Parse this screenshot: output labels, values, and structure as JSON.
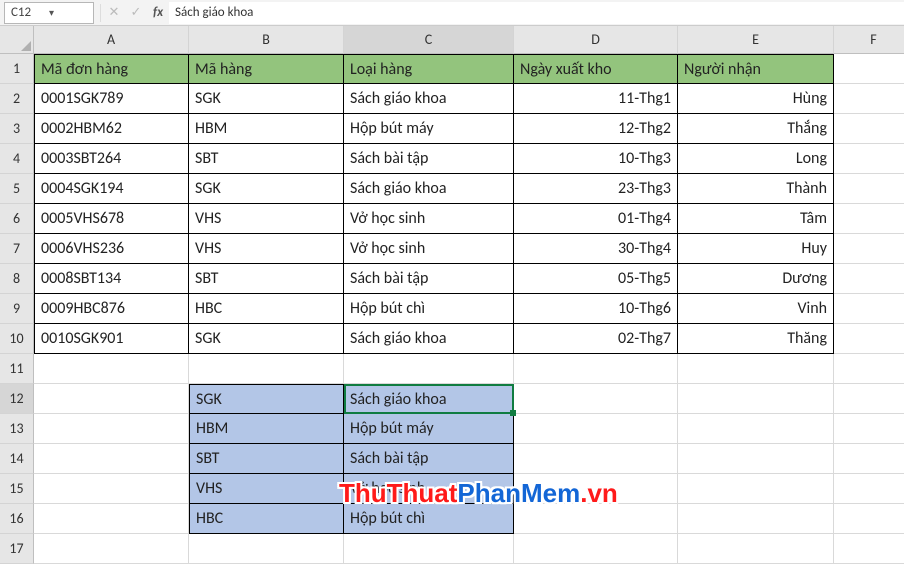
{
  "formula_bar": {
    "cell_ref": "C12",
    "formula": "Sách giáo khoa"
  },
  "columns": [
    "A",
    "B",
    "C",
    "D",
    "E",
    "F"
  ],
  "active": {
    "col": "C",
    "row": 12
  },
  "headers": {
    "A": "Mã đơn hàng",
    "B": "Mã hàng",
    "C": "Loại hàng",
    "D": "Ngày xuất kho",
    "E": "Người nhận"
  },
  "rows": [
    {
      "A": "0001SGK789",
      "B": "SGK",
      "C": "Sách giáo khoa",
      "D": "11-Thg1",
      "E": "Hùng"
    },
    {
      "A": "0002HBM62",
      "B": "HBM",
      "C": "Hộp bút máy",
      "D": "12-Thg2",
      "E": "Thắng"
    },
    {
      "A": "0003SBT264",
      "B": "SBT",
      "C": "Sách bài tập",
      "D": "10-Thg3",
      "E": "Long"
    },
    {
      "A": "0004SGK194",
      "B": "SGK",
      "C": "Sách giáo khoa",
      "D": "23-Thg3",
      "E": "Thành"
    },
    {
      "A": "0005VHS678",
      "B": "VHS",
      "C": "Vở học sinh",
      "D": "01-Thg4",
      "E": "Tâm"
    },
    {
      "A": "0006VHS236",
      "B": "VHS",
      "C": "Vở học sinh",
      "D": "30-Thg4",
      "E": "Huy"
    },
    {
      "A": "0008SBT134",
      "B": "SBT",
      "C": "Sách bài tập",
      "D": "05-Thg5",
      "E": "Dương"
    },
    {
      "A": "0009HBC876",
      "B": "HBC",
      "C": "Hộp bút chì",
      "D": "10-Thg6",
      "E": "Vinh"
    },
    {
      "A": "0010SGK901",
      "B": "SGK",
      "C": "Sách giáo khoa",
      "D": "02-Thg7",
      "E": "Thăng"
    }
  ],
  "lookup": [
    {
      "B": "SGK",
      "C": "Sách giáo khoa"
    },
    {
      "B": "HBM",
      "C": "Hộp bút máy"
    },
    {
      "B": "SBT",
      "C": "Sách bài tập"
    },
    {
      "B": "VHS",
      "C": "Vở học sinh"
    },
    {
      "B": "HBC",
      "C": "Hộp bút chì"
    }
  ],
  "watermark": {
    "part1": "ThuThuat",
    "part2": "PhanMem",
    "part3": ".vn"
  }
}
